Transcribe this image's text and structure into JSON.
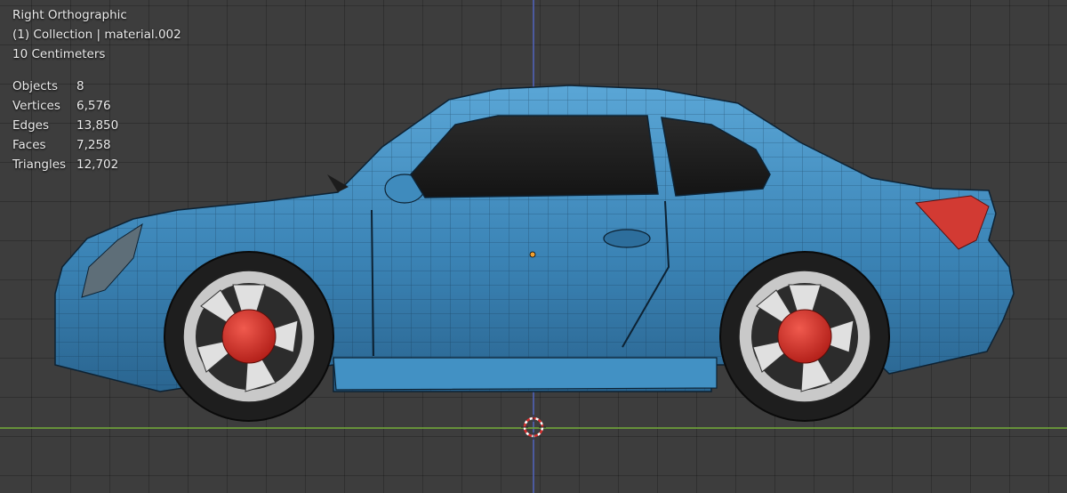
{
  "viewport": {
    "view_name": "Right Orthographic",
    "collection": "(1) Collection | material.002",
    "scale": "10 Centimeters"
  },
  "stats": [
    {
      "label": "Objects",
      "value": "8"
    },
    {
      "label": "Vertices",
      "value": "6,576"
    },
    {
      "label": "Edges",
      "value": "13,850"
    },
    {
      "label": "Faces",
      "value": "7,258"
    },
    {
      "label": "Triangles",
      "value": "12,702"
    }
  ],
  "colors": {
    "background": "#3d3d3d",
    "car_body": "#3d86b8",
    "hub": "#d8322a",
    "taillight": "#d23a33",
    "z_axis": "#4f5fb0",
    "y_axis": "#6a9a3a"
  },
  "icons": {
    "cursor": "3d-cursor-icon",
    "origin": "object-origin-icon"
  }
}
